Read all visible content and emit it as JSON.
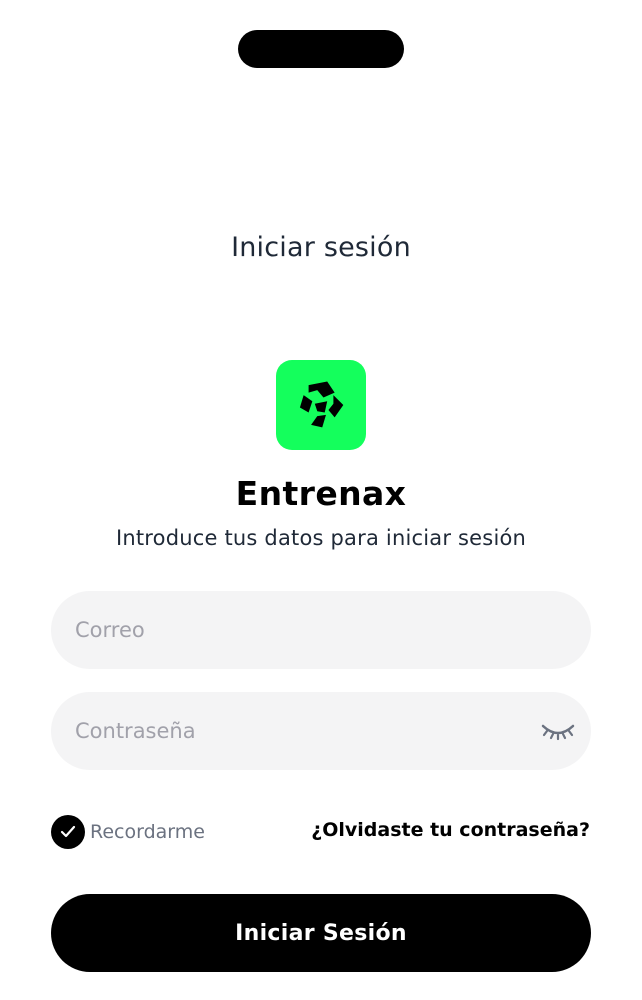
{
  "header": {
    "title": "Iniciar sesión"
  },
  "brand": {
    "name": "Entrenax",
    "tagline": "Introduce tus datos para iniciar sesión",
    "logo_color": "#14ff5c",
    "logo_icon": "entrenax-logo-icon"
  },
  "form": {
    "email": {
      "placeholder": "Correo",
      "value": ""
    },
    "password": {
      "placeholder": "Contraseña",
      "value": "",
      "toggle_icon": "eye-closed-icon"
    },
    "remember": {
      "label": "Recordarme",
      "checked": true
    },
    "forgot_label": "¿Olvidaste tu contraseña?",
    "submit_label": "Iniciar Sesión"
  }
}
